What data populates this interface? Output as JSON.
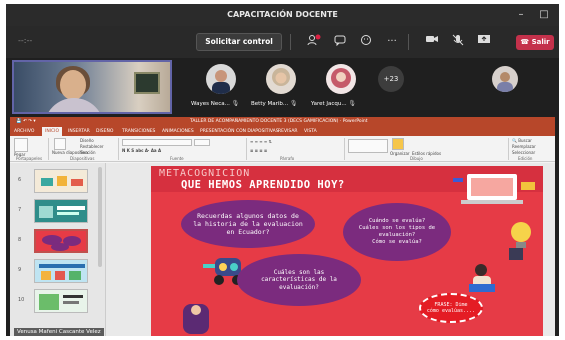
{
  "window": {
    "title": "CAPACITACIÓN DOCENTE",
    "timer": "--:--"
  },
  "toolbar": {
    "control_label": "Solicitar control",
    "leave_label": "Salir"
  },
  "participants": {
    "tiles": [
      {
        "name": "Wayes Neca...",
        "avatar_color": "#1f2d4a"
      },
      {
        "name": "Betty Marib...",
        "avatar_color": "#c9b59a"
      },
      {
        "name": "Yaret Jacqu...",
        "avatar_color": "#c55a6a"
      }
    ],
    "more_count": "+23",
    "self_name": "Venusa Mafeni Cascante Velez"
  },
  "ppt": {
    "title_text": "TALLER DE ACOMPAÑAMIENTO DOCENTE 3 (DECS GAMIFICACION)  ·  PowerPoint",
    "tabs": [
      "ARCHIVO",
      "INICIO",
      "INSERTAR",
      "DISEÑO",
      "TRANSICIONES",
      "ANIMACIONES",
      "PRESENTACIÓN CON DIAPOSITIVAS",
      "REVISAR",
      "VISTA"
    ],
    "ribbon_groups": [
      "Portapapeles",
      "Diapositivas",
      "Fuente",
      "Párrafo",
      "Dibujo",
      "Edición"
    ],
    "ribbon_items": {
      "paste": "Pegar",
      "new_slide": "Nueva diapositiva",
      "design": "Diseño",
      "reset": "Restablecer",
      "section": "Sección",
      "arrange": "Organizar",
      "quick_styles": "Estilos rápidos",
      "find": "Buscar",
      "replace": "Reemplazar",
      "select": "Seleccionar"
    },
    "thumbnail_numbers": [
      "6",
      "7",
      "8",
      "9",
      "10"
    ]
  },
  "slide": {
    "kicker": "METACOGNICION",
    "title": "QUE HEMOS APRENDIDO HOY?",
    "bubble1": [
      "Recuerdas algunos datos de",
      "la historia de la evaluacion",
      "en Ecuador?"
    ],
    "bubble2": [
      "Cuándo se evalúa?",
      "Cuáles son los tipos de",
      "evaluación?",
      "Cómo se evalúa?"
    ],
    "bubble3": [
      "Cuáles son las",
      "características de la",
      "evaluación?"
    ],
    "frase": [
      "FRASE: Dime",
      "cómo evalúas...."
    ]
  },
  "colors": {
    "accent": "#c4314b",
    "ppt_brand": "#b7472a",
    "slide_bg": "#e63b46",
    "bubble": "#7b2b7e"
  }
}
